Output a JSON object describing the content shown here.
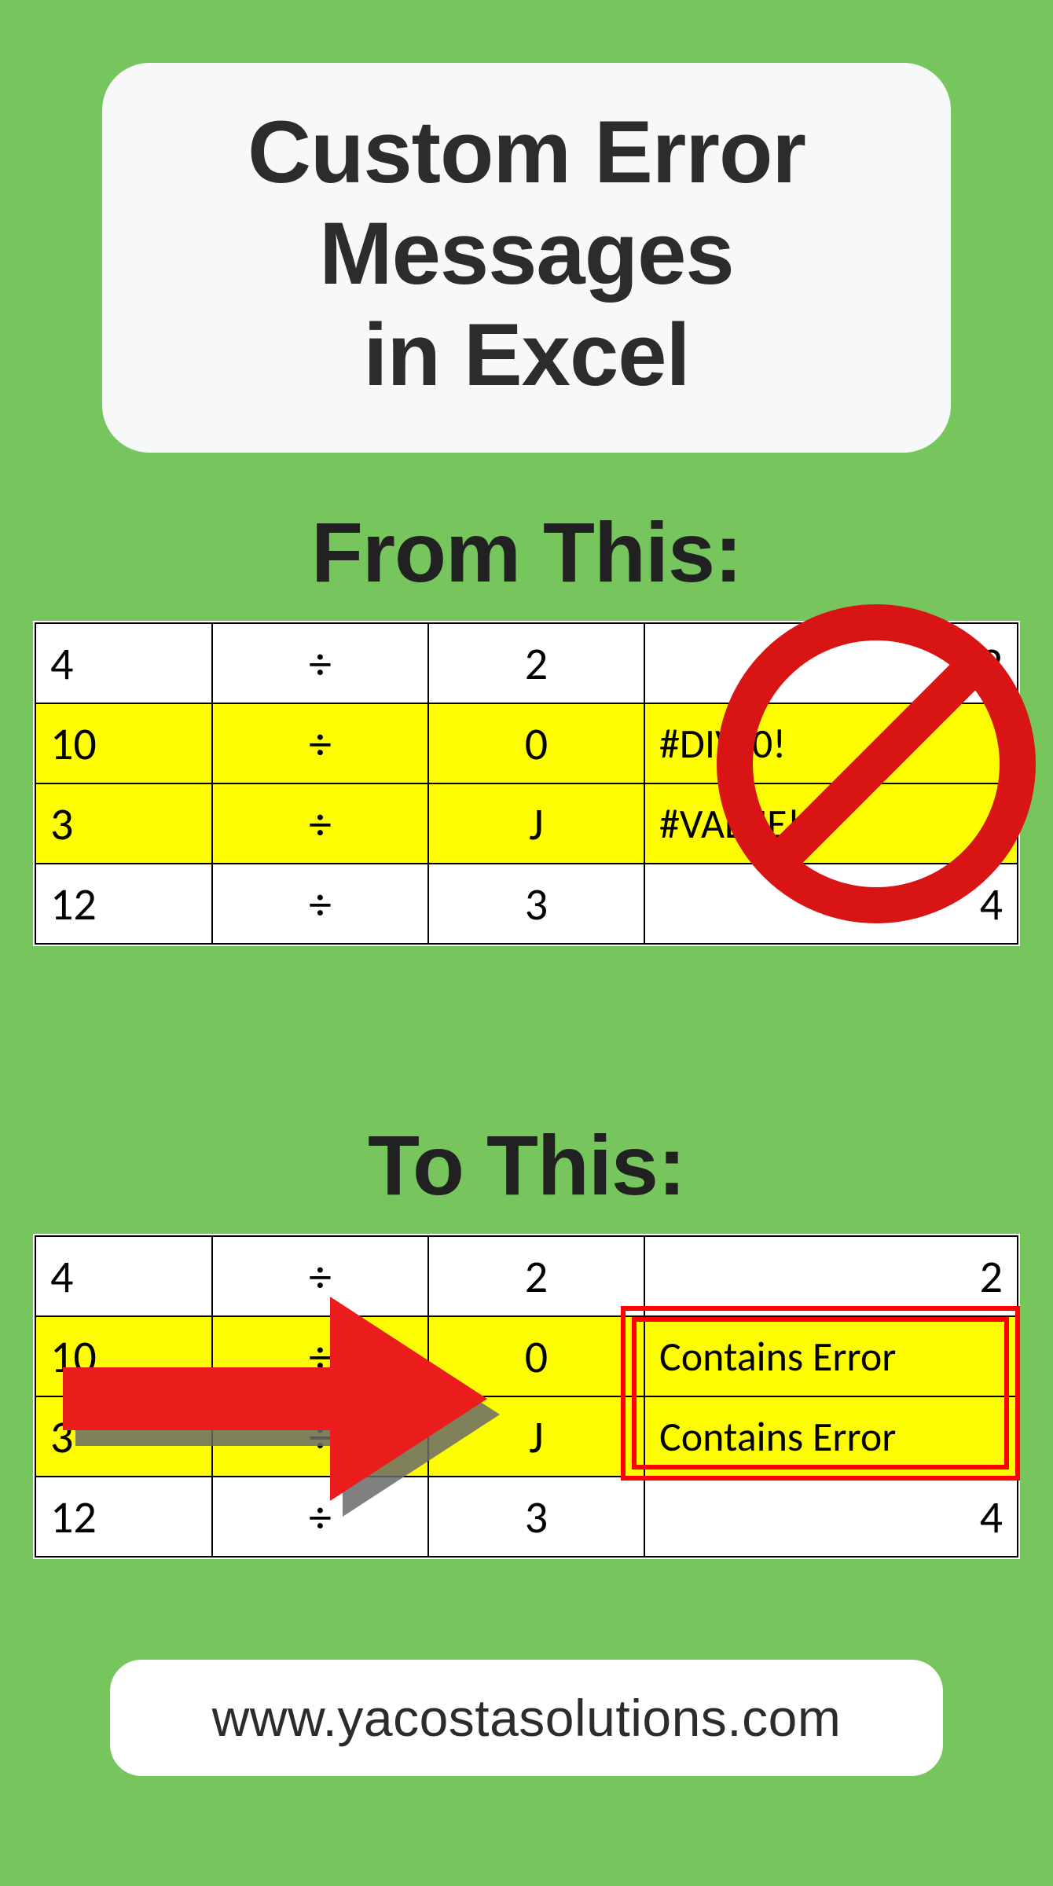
{
  "title_lines": [
    "Custom Error",
    "Messages",
    "in Excel"
  ],
  "labels": {
    "from": "From This:",
    "to": "To This:"
  },
  "colors": {
    "background": "#76c65d",
    "highlight": "#fdfc02",
    "accent_red": "#e31b1b"
  },
  "table_from": {
    "rows": [
      {
        "a": "4",
        "op": "÷",
        "c": "2",
        "d": "2",
        "hl": false,
        "err": false
      },
      {
        "a": "10",
        "op": "÷",
        "c": "0",
        "d": "#DIV/0!",
        "hl": true,
        "err": true
      },
      {
        "a": "3",
        "op": "÷",
        "c": "J",
        "d": "#VALUE!",
        "hl": true,
        "err": true
      },
      {
        "a": "12",
        "op": "÷",
        "c": "3",
        "d": "4",
        "hl": false,
        "err": false
      }
    ]
  },
  "table_to": {
    "rows": [
      {
        "a": "4",
        "op": "÷",
        "c": "2",
        "d": "2",
        "hl": false,
        "err": false
      },
      {
        "a": "10",
        "op": "÷",
        "c": "0",
        "d": "Contains Error",
        "hl": true,
        "err": true
      },
      {
        "a": "3",
        "op": "÷",
        "c": "J",
        "d": "Contains Error",
        "hl": true,
        "err": true
      },
      {
        "a": "12",
        "op": "÷",
        "c": "3",
        "d": "4",
        "hl": false,
        "err": false
      }
    ]
  },
  "footer_url": "www.yacostasolutions.com"
}
